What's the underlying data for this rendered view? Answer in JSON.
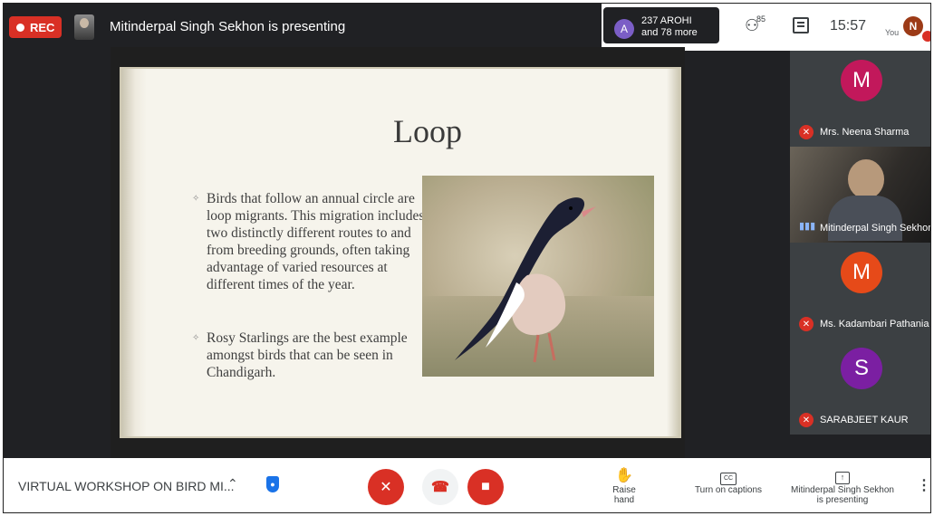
{
  "topbar": {
    "rec_label": "REC",
    "presenting_text": "Mitinderpal Singh Sekhon is presenting",
    "participant_avatar_letter": "A",
    "participant_line1": "237 AROHI",
    "participant_line2": "and 78 more",
    "people_count": "85",
    "time": "15:57",
    "you_label": "You",
    "self_avatar_letter": "N"
  },
  "slide": {
    "title": "Loop",
    "bullets": [
      "Birds that follow an annual circle are loop migrants. This migration includes two distinctly different routes to and from breeding grounds, often taking advantage of varied resources at different times of the year.",
      "Rosy Starlings are the best example amongst birds that can be seen in Chandigarh."
    ]
  },
  "participants": [
    {
      "letter": "M",
      "name": "Mrs. Neena Sharma",
      "color": "#c2185b"
    },
    {
      "letter": "",
      "name": "Mitinderpal Singh Sekhon",
      "color": ""
    },
    {
      "letter": "M",
      "name": "Ms. Kadambari Pathania",
      "color": "#e64a19"
    },
    {
      "letter": "S",
      "name": "SARABJEET KAUR",
      "color": "#7b1fa2"
    }
  ],
  "bottombar": {
    "meeting_title": "VIRTUAL WORKSHOP ON BIRD MI...",
    "raise_hand": "Raise hand",
    "captions": "Turn on captions",
    "presenting_line1": "Mitinderpal Singh Sekhon",
    "presenting_line2": "is presenting"
  },
  "colors": {
    "accent_red": "#d93025",
    "background_dark": "#202124",
    "slide_background": "#f6f4ec"
  },
  "icons": {
    "shield": "shield-lock-icon",
    "mic": "mic-off-icon",
    "hangup": "hangup-icon",
    "camera": "camera-off-icon",
    "hand": "hand-icon",
    "captions": "cc-icon",
    "present": "present-icon",
    "more": "more-vert-icon"
  }
}
